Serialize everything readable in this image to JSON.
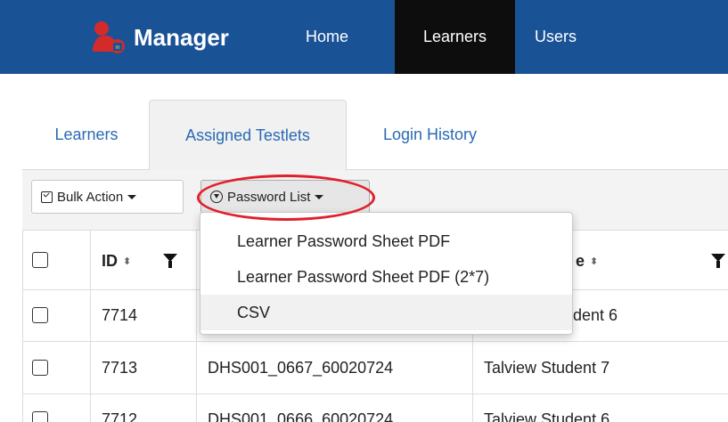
{
  "navbar": {
    "brand": "Manager",
    "items": [
      {
        "label": "Home",
        "active": false
      },
      {
        "label": "Learners",
        "active": true
      },
      {
        "label": "Users",
        "active": false
      }
    ],
    "bg_color": "#1a5296",
    "active_color": "#0d0d0d"
  },
  "tabs": [
    {
      "label": "Learners",
      "active": false
    },
    {
      "label": "Assigned Testlets",
      "active": true
    },
    {
      "label": "Login History",
      "active": false
    }
  ],
  "toolbar": {
    "bulk_action_label": "Bulk Action",
    "password_list_label": "Password List"
  },
  "table": {
    "headers": {
      "id": "ID",
      "name_partial": "e"
    },
    "rows": [
      {
        "id": "7714",
        "username": "",
        "name": "dent 6"
      },
      {
        "id": "7713",
        "username": "DHS001_0667_60020724",
        "name": "Talview Student 7"
      },
      {
        "id": "7712",
        "username": "DHS001_0666_60020724",
        "name": "Talview Student 6"
      }
    ]
  },
  "dropdown": {
    "items": [
      {
        "label": "Learner Password Sheet PDF"
      },
      {
        "label": "Learner Password Sheet PDF (2*7)"
      },
      {
        "label": "CSV"
      }
    ]
  },
  "colors": {
    "link": "#2a6ab3",
    "annotation": "#e0202c",
    "logo_red": "#d42a2a"
  }
}
